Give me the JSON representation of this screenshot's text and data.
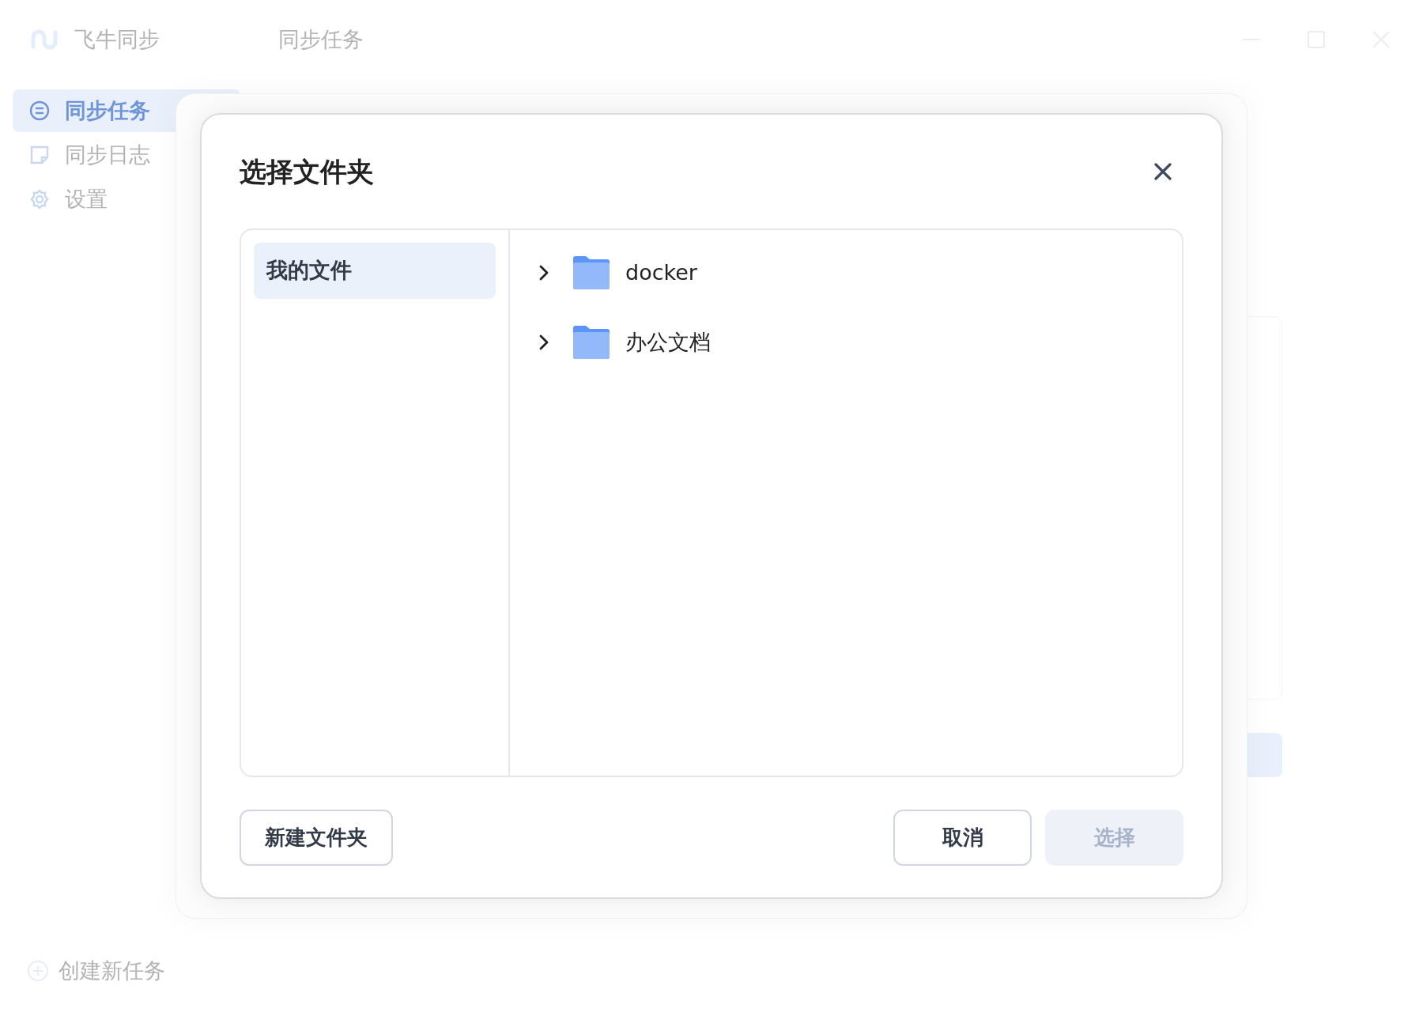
{
  "app": {
    "name": "飞牛同步",
    "page_title": "同步任务"
  },
  "sidebar": {
    "items": [
      {
        "label": "同步任务",
        "selected": true
      },
      {
        "label": "同步日志",
        "selected": false
      },
      {
        "label": "设置",
        "selected": false
      }
    ],
    "create_button": "创建新任务"
  },
  "dialog": {
    "title": "选择文件夹",
    "locations": [
      {
        "label": "我的文件",
        "selected": true
      }
    ],
    "folders": [
      {
        "name": "docker",
        "expanded": false
      },
      {
        "name": "办公文档",
        "expanded": false
      }
    ],
    "buttons": {
      "new_folder": "新建文件夹",
      "cancel": "取消",
      "select": {
        "label": "选择",
        "disabled": true
      }
    }
  }
}
